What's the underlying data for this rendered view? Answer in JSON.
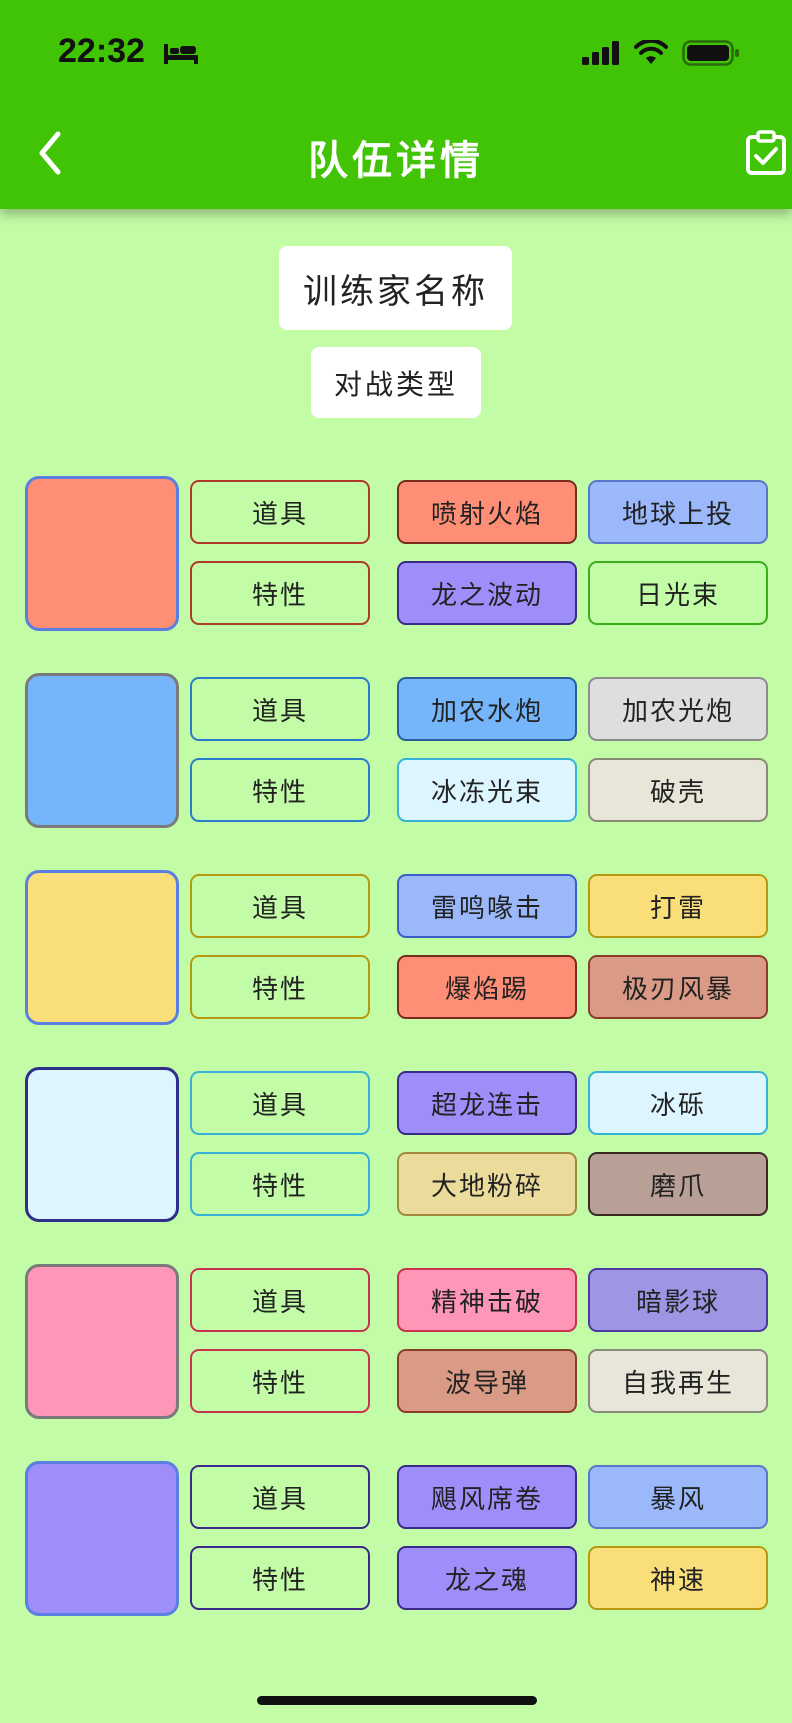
{
  "status_bar": {
    "time": "22:32"
  },
  "nav": {
    "title": "队伍详情"
  },
  "trainer": {
    "name": "训练家名称",
    "battle_type": "对战类型"
  },
  "team": [
    {
      "color": "#fe8e76",
      "border": "#5a7fe0",
      "item": "道具",
      "ability": "特性",
      "slot_border": "#b03a2a",
      "moves": [
        {
          "name": "喷射火焰",
          "bg": "#fe8e76",
          "border": "#7a2d1e"
        },
        {
          "name": "地球上投",
          "bg": "#9ab8fa",
          "border": "#5877c9"
        },
        {
          "name": "龙之波动",
          "bg": "#9e8efa",
          "border": "#3b2a8a"
        },
        {
          "name": "日光束",
          "bg": "#c2fca6",
          "border": "#3aae1a"
        }
      ]
    },
    {
      "color": "#75b5fa",
      "border": "#7a7a7a",
      "item": "道具",
      "ability": "特性",
      "slot_border": "#2a7bc9",
      "moves": [
        {
          "name": "加农水炮",
          "bg": "#75b5fa",
          "border": "#2a5d9a"
        },
        {
          "name": "加农光炮",
          "bg": "#dedede",
          "border": "#8c8c8c"
        },
        {
          "name": "冰冻光束",
          "bg": "#dcf5fe",
          "border": "#35b2d6"
        },
        {
          "name": "破壳",
          "bg": "#e7e6d8",
          "border": "#8a8a78"
        }
      ]
    },
    {
      "color": "#fade7a",
      "border": "#5a7fe0",
      "item": "道具",
      "ability": "特性",
      "slot_border": "#b59a10",
      "moves": [
        {
          "name": "雷鸣喙击",
          "bg": "#9ab8fa",
          "border": "#3a5ec9"
        },
        {
          "name": "打雷",
          "bg": "#fade7a",
          "border": "#b59a10"
        },
        {
          "name": "爆焰踢",
          "bg": "#fe8e76",
          "border": "#7a2d1e"
        },
        {
          "name": "极刃风暴",
          "bg": "#d99b86",
          "border": "#8a3e2a"
        }
      ]
    },
    {
      "color": "#dcf5fe",
      "border": "#2f2f8a",
      "item": "道具",
      "ability": "特性",
      "slot_border": "#35b2d6",
      "moves": [
        {
          "name": "超龙连击",
          "bg": "#9e8efa",
          "border": "#3b2a8a"
        },
        {
          "name": "冰砾",
          "bg": "#dcf5fe",
          "border": "#35b2d6"
        },
        {
          "name": "大地粉碎",
          "bg": "#ecdc9c",
          "border": "#a08a3c"
        },
        {
          "name": "磨爪",
          "bg": "#b8a096",
          "border": "#3a2a22"
        }
      ]
    },
    {
      "color": "#fe96b8",
      "border": "#7a7a7a",
      "item": "道具",
      "ability": "特性",
      "slot_border": "#c9324e",
      "moves": [
        {
          "name": "精神击破",
          "bg": "#fe96b8",
          "border": "#c9324e"
        },
        {
          "name": "暗影球",
          "bg": "#9e96e4",
          "border": "#4a3aa0"
        },
        {
          "name": "波导弹",
          "bg": "#d99b86",
          "border": "#8a3e2a"
        },
        {
          "name": "自我再生",
          "bg": "#e7e6d8",
          "border": "#8a8a78"
        }
      ]
    },
    {
      "color": "#9e8efa",
      "border": "#5a7fe0",
      "item": "道具",
      "ability": "特性",
      "slot_border": "#3b2a8a",
      "moves": [
        {
          "name": "飓风席卷",
          "bg": "#9e8efa",
          "border": "#3b2a8a"
        },
        {
          "name": "暴风",
          "bg": "#9ab8fa",
          "border": "#5877c9"
        },
        {
          "name": "龙之魂",
          "bg": "#9e8efa",
          "border": "#3b2a8a"
        },
        {
          "name": "神速",
          "bg": "#fade7a",
          "border": "#b59a10"
        }
      ]
    }
  ]
}
